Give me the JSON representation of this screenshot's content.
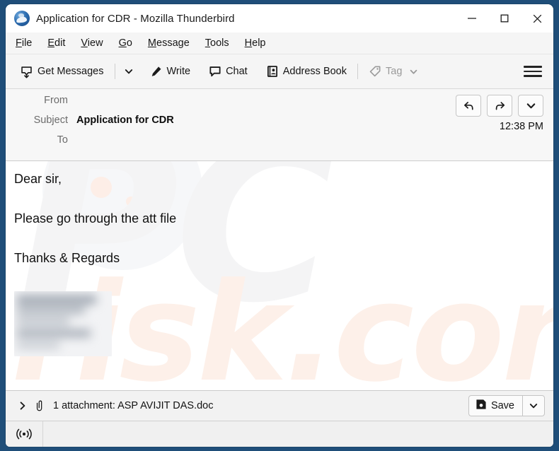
{
  "window": {
    "title": "Application for CDR - Mozilla Thunderbird",
    "app_icon": "thunderbird-logo",
    "controls": {
      "minimize": "minimize-icon",
      "maximize": "maximize-icon",
      "close": "close-icon"
    }
  },
  "menubar": {
    "items": [
      {
        "label": "File",
        "accel": "F"
      },
      {
        "label": "Edit",
        "accel": "E"
      },
      {
        "label": "View",
        "accel": "V"
      },
      {
        "label": "Go",
        "accel": "G"
      },
      {
        "label": "Message",
        "accel": "M"
      },
      {
        "label": "Tools",
        "accel": "T"
      },
      {
        "label": "Help",
        "accel": "H"
      }
    ]
  },
  "toolbar": {
    "get_messages_label": "Get Messages",
    "get_messages_icon": "inbox-download-icon",
    "get_messages_caret": "chevron-down-icon",
    "write_label": "Write",
    "write_icon": "pencil-icon",
    "chat_label": "Chat",
    "chat_icon": "speech-bubble-icon",
    "address_book_label": "Address Book",
    "address_book_icon": "address-book-icon",
    "tag_label": "Tag",
    "tag_icon": "tag-icon",
    "tag_caret": "chevron-down-icon",
    "tag_disabled": true,
    "app_menu_icon": "hamburger-menu-icon"
  },
  "message_header": {
    "from_label": "From",
    "from_value": "",
    "subject_label": "Subject",
    "subject_value": "Application for CDR",
    "to_label": "To",
    "to_value": "",
    "time": "12:38 PM",
    "actions": {
      "reply": "reply-arrow-icon",
      "forward": "forward-arrow-icon",
      "more": "chevron-down-icon"
    }
  },
  "message_body": {
    "lines": [
      "Dear sir,",
      "Please go through the att file",
      "Thanks & Regards"
    ],
    "signature_image": "blurred-signature-image",
    "watermark_primary": "PC",
    "watermark_secondary": "risk.com"
  },
  "attachment_bar": {
    "expand_icon": "chevron-right-icon",
    "clip_icon": "paperclip-icon",
    "text": "1 attachment: ASP AVIJIT DAS.doc",
    "save_label": "Save",
    "save_icon": "save-disk-icon",
    "save_caret": "chevron-down-icon"
  },
  "status_bar": {
    "icon": "broadcast-signal-icon"
  },
  "colors": {
    "desktop": "#1f4e79",
    "window": "#ffffff",
    "toolbar": "#f5f5f5",
    "header": "#f7f7f7",
    "disabled_text": "#9a9a9a",
    "watermark_grey": "#f4f4f5",
    "watermark_peach": "#fdf0e9"
  }
}
